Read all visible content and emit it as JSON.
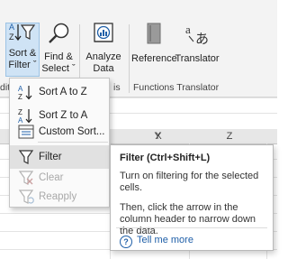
{
  "ribbon": {
    "sort_filter": {
      "line1": "Sort &",
      "line2": "Filter ˇ"
    },
    "find_select": {
      "line1": "Find &",
      "line2": "Select ˇ"
    },
    "analyze_data": {
      "line1": "Analyze",
      "line2": "Data"
    },
    "reference": {
      "label": "Reference"
    },
    "translator": {
      "label": "Translator"
    },
    "groups": {
      "editing_fragment": "diti",
      "analysis_fragment": "is",
      "functions_translator": "Functions Translator"
    }
  },
  "sheet": {
    "columns": [
      "X",
      "Y",
      "Z"
    ]
  },
  "menu": {
    "items": [
      {
        "label": "Sort A to Z",
        "icon": "sort-az-icon",
        "enabled": true
      },
      {
        "label": "Sort Z to A",
        "icon": "sort-za-icon",
        "enabled": true
      },
      {
        "label": "Custom Sort...",
        "icon": "custom-sort-icon",
        "enabled": true
      },
      {
        "label": "Filter",
        "icon": "filter-icon",
        "enabled": true,
        "highlighted": true
      },
      {
        "label": "Clear",
        "icon": "clear-filter-icon",
        "enabled": false
      },
      {
        "label": "Reapply",
        "icon": "reapply-icon",
        "enabled": false
      }
    ]
  },
  "tooltip": {
    "title": "Filter (Ctrl+Shift+L)",
    "para1": "Turn on filtering for the selected cells.",
    "para2": "Then, click the arrow in the column header to narrow down the data.",
    "help_icon": "?",
    "help_link": "Tell me more"
  },
  "colors": {
    "accent": "#1f5fa8",
    "ribbon_bg": "#f3f3f3",
    "menu_hover": "#e1e1e1"
  }
}
